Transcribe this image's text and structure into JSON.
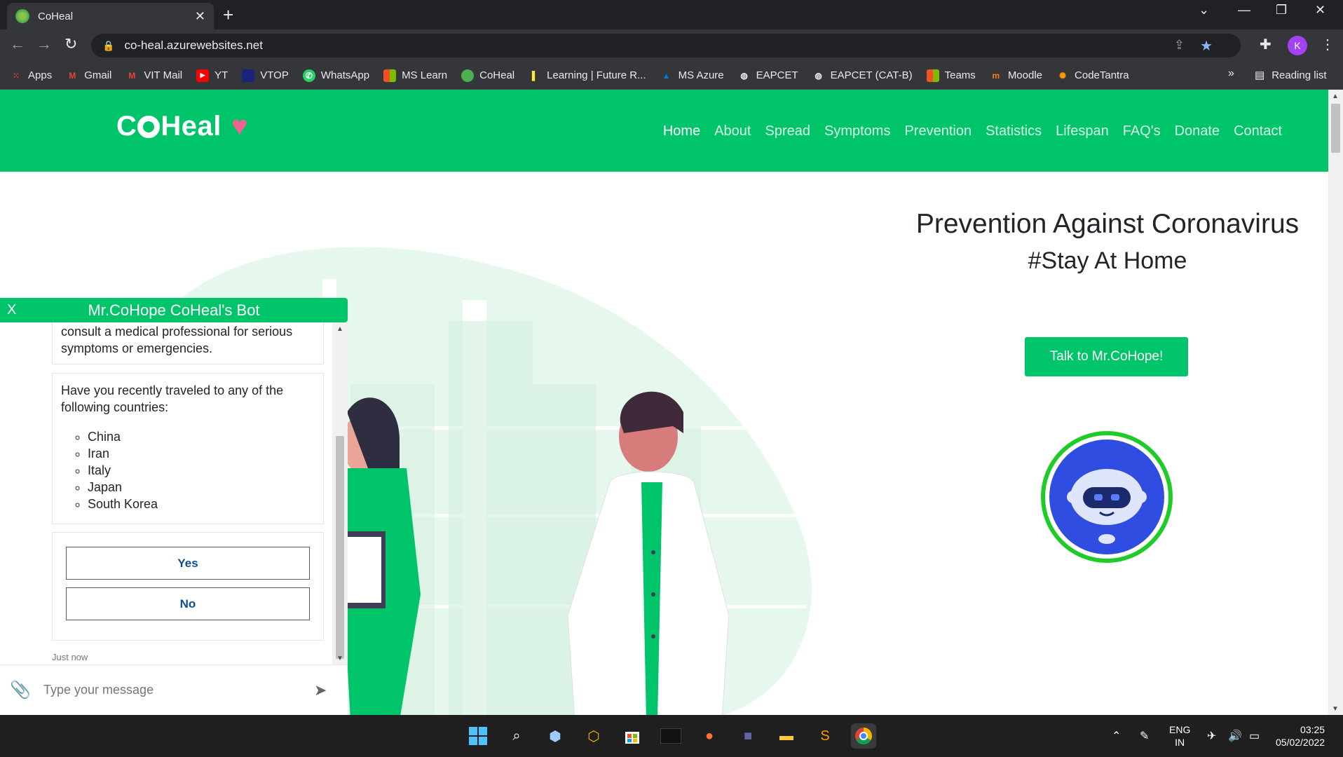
{
  "browser": {
    "tab_title": "CoHeal",
    "url": "co-heal.azurewebsites.net",
    "profile_initial": "K",
    "bookmarks": [
      {
        "label": "Apps",
        "icon": "apps-grid-icon",
        "color": "#ea4335"
      },
      {
        "label": "Gmail",
        "icon": "gmail-icon",
        "color": "#ea4335"
      },
      {
        "label": "VIT Mail",
        "icon": "gmail-icon",
        "color": "#ea4335"
      },
      {
        "label": "YT",
        "icon": "youtube-icon",
        "color": "#ff0000"
      },
      {
        "label": "VTOP",
        "icon": "vtop-icon",
        "color": "#1a237e"
      },
      {
        "label": "WhatsApp",
        "icon": "whatsapp-icon",
        "color": "#25d366"
      },
      {
        "label": "MS Learn",
        "icon": "microsoft-icon",
        "color": "#f25022"
      },
      {
        "label": "CoHeal",
        "icon": "coheal-icon",
        "color": "#4caf50"
      },
      {
        "label": "Learning | Future R...",
        "icon": "futurelearn-icon",
        "color": "#ffeb3b"
      },
      {
        "label": "MS Azure",
        "icon": "azure-icon",
        "color": "#0078d4"
      },
      {
        "label": "EAPCET",
        "icon": "globe-icon",
        "color": "#e8eaed"
      },
      {
        "label": "EAPCET (CAT-B)",
        "icon": "globe-icon",
        "color": "#e8eaed"
      },
      {
        "label": "Teams",
        "icon": "microsoft-icon",
        "color": "#f25022"
      },
      {
        "label": "Moodle",
        "icon": "moodle-icon",
        "color": "#f98012"
      },
      {
        "label": "CodeTantra",
        "icon": "codetantra-icon",
        "color": "#ff9800"
      }
    ],
    "more_bookmarks": "»",
    "reading_list": "Reading list"
  },
  "site": {
    "logo_text_left": "C",
    "logo_text_right": "Heal",
    "nav": [
      "Home",
      "About",
      "Spread",
      "Symptoms",
      "Prevention",
      "Statistics",
      "Lifespan",
      "FAQ's",
      "Donate",
      "Contact"
    ],
    "hero_title": "Prevention Against Coronavirus",
    "hero_subtitle": "#Stay At Home",
    "cta_label": "Talk to Mr.CoHope!"
  },
  "chat": {
    "close_label": "X",
    "title": "Mr.CoHope CoHeal's Bot",
    "partial_message": "advice, diagnosis, or treatment. Always consult a medical professional for serious symptoms or emergencies.",
    "question": "Have you recently traveled to any of the following countries:",
    "countries": [
      "China",
      "Iran",
      "Italy",
      "Japan",
      "South Korea"
    ],
    "yes_label": "Yes",
    "no_label": "No",
    "timestamp": "Just now",
    "input_placeholder": "Type your message"
  },
  "taskbar": {
    "lang_line1": "ENG",
    "lang_line2": "IN",
    "time": "03:25",
    "date": "05/02/2022"
  },
  "colors": {
    "brand_green": "#00c46a",
    "heart_pink": "#f06292",
    "bot_blue": "#2f4de0",
    "bot_ring": "#1fcb26"
  }
}
